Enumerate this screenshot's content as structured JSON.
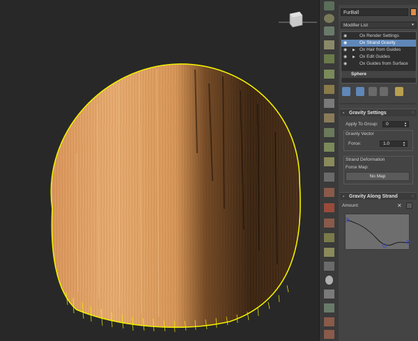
{
  "object": {
    "name": "FurBall",
    "color": "#e08d48"
  },
  "modifier_list": {
    "label": "Modifier List",
    "arrow": "▾"
  },
  "stack": [
    {
      "label": "Ox Render Settings",
      "selected": false,
      "expand": ""
    },
    {
      "label": "Ox Strand Gravity",
      "selected": true,
      "expand": ""
    },
    {
      "label": "Ox Hair from Guides",
      "selected": false,
      "expand": "▶"
    },
    {
      "label": "Ox Edit Guides",
      "selected": false,
      "expand": "▶"
    },
    {
      "label": "Ox Guides from Surface",
      "selected": false,
      "expand": ""
    }
  ],
  "stack_base": "Sphere",
  "gravity_settings": {
    "title": "Gravity Settings",
    "apply_to_group_label": "Apply To Group:",
    "apply_to_group_value": "0",
    "gravity_vector_label": "Gravity Vector",
    "force_label": "Force:",
    "force_value": "1.0",
    "strand_deformation_label": "Strand Deformation",
    "force_map_label": "Force Map:",
    "no_map_label": "No Map"
  },
  "gravity_along_strand": {
    "title": "Gravity Along Strand",
    "amount_label": "Amount:"
  },
  "rollout_sign": "-",
  "rollout_dots": "::",
  "colors": {
    "fur_light": "#e6a86a",
    "fur_dark": "#2a1a0e",
    "selection_yellow": "#f2f000",
    "selected_row": "#5f87b8",
    "panel_bg": "#444444"
  }
}
